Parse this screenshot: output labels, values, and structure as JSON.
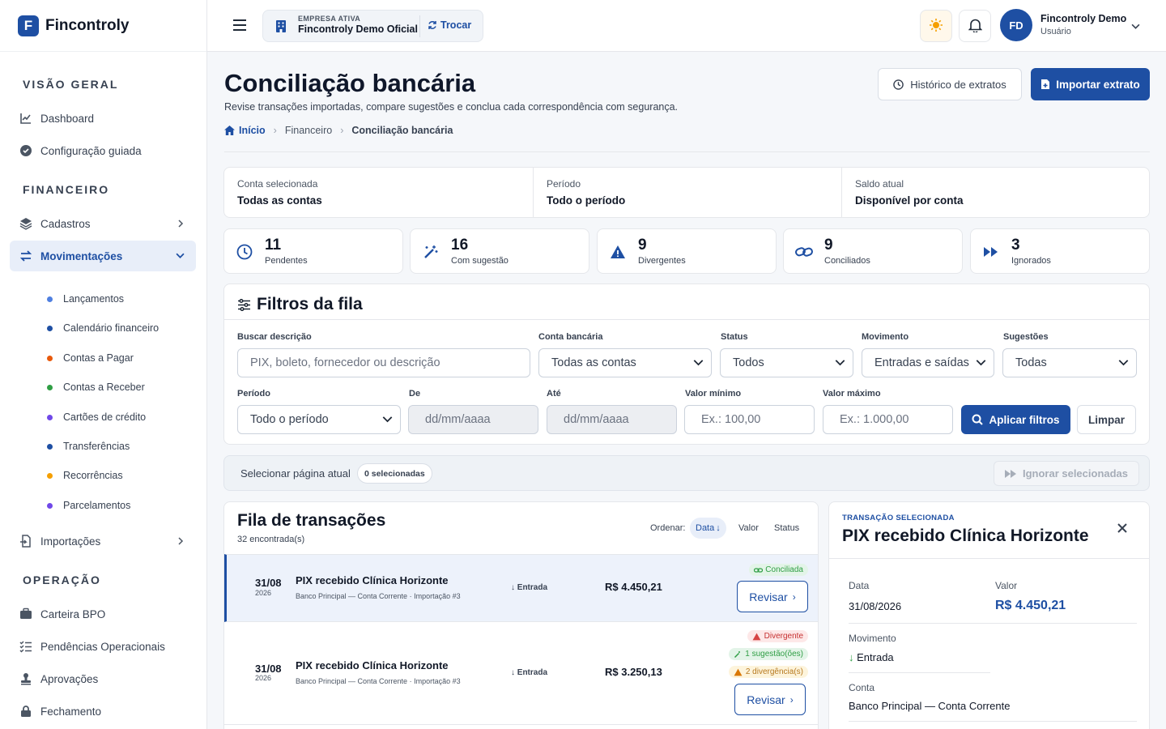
{
  "app": {
    "logo_letter": "F",
    "name": "Fincontroly"
  },
  "sidebar": {
    "sections": {
      "overview": "VISÃO GERAL",
      "financial": "FINANCEIRO",
      "operation": "OPERAÇÃO"
    },
    "items": {
      "dashboard": "Dashboard",
      "guided_setup": "Configuração guiada",
      "registers": "Cadastros",
      "movements": "Movimentações",
      "imports": "Importações",
      "bpo_portfolio": "Carteira BPO",
      "op_pending": "Pendências Operacionais",
      "approvals": "Aprovações",
      "closing": "Fechamento"
    },
    "sub_items": [
      {
        "label": "Lançamentos",
        "color": "#4f7fe0"
      },
      {
        "label": "Calendário financeiro",
        "color": "#1e4fa3"
      },
      {
        "label": "Contas a Pagar",
        "color": "#e8590c"
      },
      {
        "label": "Contas a Receber",
        "color": "#2f9e44"
      },
      {
        "label": "Cartões de crédito",
        "color": "#7048e8"
      },
      {
        "label": "Transferências",
        "color": "#1e4fa3"
      },
      {
        "label": "Recorrências",
        "color": "#f59f00"
      },
      {
        "label": "Parcelamentos",
        "color": "#7048e8"
      }
    ]
  },
  "topbar": {
    "company_label": "EMPRESA ATIVA",
    "company_name": "Fincontroly Demo Oficial",
    "switch_label": "Trocar",
    "user_initials": "FD",
    "user_name": "Fincontroly Demo",
    "user_role": "Usuário"
  },
  "page": {
    "title": "Conciliação bancária",
    "subtitle": "Revise transações importadas, compare sugestões e conclua cada correspondência com segurança.",
    "history_button": "Histórico de extratos",
    "import_button": "Importar extrato",
    "breadcrumb": [
      "Início",
      "Financeiro",
      "Conciliação bancária"
    ]
  },
  "summary": [
    {
      "label": "Conta selecionada",
      "value": "Todas as contas"
    },
    {
      "label": "Período",
      "value": "Todo o período"
    },
    {
      "label": "Saldo atual",
      "value": "Disponível por conta"
    }
  ],
  "stats": [
    {
      "value": "11",
      "label": "Pendentes",
      "icon": "clock-icon"
    },
    {
      "value": "16",
      "label": "Com sugestão",
      "icon": "magic-wand-icon"
    },
    {
      "value": "9",
      "label": "Divergentes",
      "icon": "warning-icon"
    },
    {
      "value": "9",
      "label": "Conciliados",
      "icon": "link-icon"
    },
    {
      "value": "3",
      "label": "Ignorados",
      "icon": "fast-forward-icon"
    }
  ],
  "filters": {
    "title": "Filtros da fila",
    "search_label": "Buscar descrição",
    "search_placeholder": "PIX, boleto, fornecedor ou descrição",
    "account_label": "Conta bancária",
    "account_value": "Todas as contas",
    "status_label": "Status",
    "status_value": "Todos",
    "movement_label": "Movimento",
    "movement_value": "Entradas e saídas",
    "suggestions_label": "Sugestões",
    "suggestions_value": "Todas",
    "period_label": "Período",
    "period_value": "Todo o período",
    "from_label": "De",
    "from_placeholder": "dd/mm/aaaa",
    "to_label": "Até",
    "to_placeholder": "dd/mm/aaaa",
    "min_label": "Valor mínimo",
    "min_placeholder": "Ex.: 100,00",
    "max_label": "Valor máximo",
    "max_placeholder": "Ex.: 1.000,00",
    "apply_button": "Aplicar filtros",
    "clear_button": "Limpar"
  },
  "selection": {
    "label": "Selecionar página atual",
    "count": "0 selecionadas",
    "ignore_button": "Ignorar selecionadas"
  },
  "queue": {
    "title": "Fila de transações",
    "count": "32 encontrada(s)",
    "sort_label": "Ordenar:",
    "sort_options": [
      "Data",
      "Valor",
      "Status"
    ],
    "rows": [
      {
        "date": "31/08",
        "year": "2026",
        "description": "PIX recebido Clínica Horizonte",
        "meta": "Banco Principal — Conta Corrente · Importação #3",
        "direction": "Entrada",
        "amount": "R$ 4.450,21",
        "badges": [
          "Conciliada"
        ],
        "action": "Revisar"
      },
      {
        "date": "31/08",
        "year": "2026",
        "description": "PIX recebido Clínica Horizonte",
        "meta": "Banco Principal — Conta Corrente · Importação #3",
        "direction": "Entrada",
        "amount": "R$ 3.250,13",
        "badges": [
          "Divergente",
          "1 sugestão(ões)",
          "2 divergência(s)"
        ],
        "action": "Revisar"
      }
    ]
  },
  "detail": {
    "eyebrow": "TRANSAÇÃO SELECIONADA",
    "title": "PIX recebido Clínica Horizonte",
    "date_label": "Data",
    "date_value": "31/08/2026",
    "amount_label": "Valor",
    "amount_value": "R$ 4.450,21",
    "movement_label": "Movimento",
    "movement_value": "Entrada",
    "account_label": "Conta",
    "account_value": "Banco Principal — Conta Corrente"
  },
  "colors": {
    "primary": "#1e4fa3",
    "success": "#2f9e44",
    "danger": "#d64545",
    "warning": "#b7791f"
  }
}
